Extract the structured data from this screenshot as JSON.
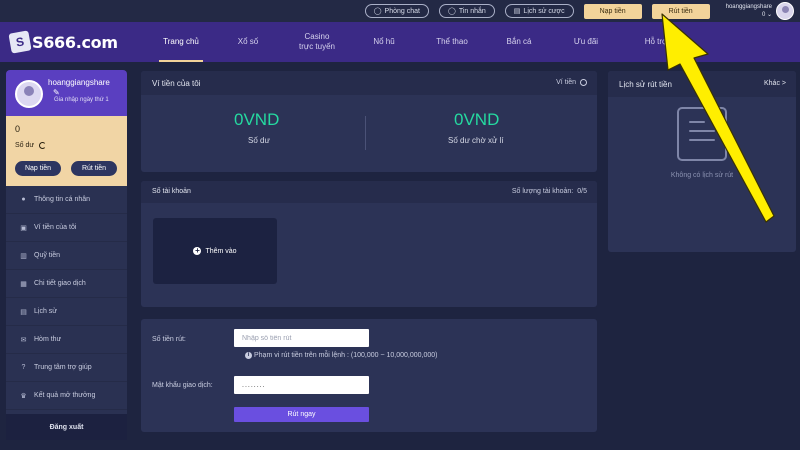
{
  "topbar": {
    "chat_label": "Phòng chat",
    "messages_label": "Tin nhắn",
    "history_label": "Lịch sử cược",
    "deposit_label": "Nạp tiền",
    "withdraw_label": "Rút tiền",
    "username": "hoanggiangshare",
    "balance": "0"
  },
  "brand": {
    "logo_text": "S666.com",
    "logo_mark": "S"
  },
  "nav": {
    "items": [
      {
        "label": "Trang chủ"
      },
      {
        "label": "Xổ số"
      },
      {
        "label": "Casino\ntrực tuyến"
      },
      {
        "label": "Nổ hũ"
      },
      {
        "label": "Thể thao"
      },
      {
        "label": "Bắn cá"
      },
      {
        "label": "Ưu đãi"
      },
      {
        "label": "Hỗ trợ"
      }
    ]
  },
  "profile": {
    "name": "hoanggiangshare",
    "subtitle": "Gia nhập ngày thứ 1",
    "balance_value": "0",
    "balance_label": "Số dư",
    "deposit_button": "Nạp tiền",
    "withdraw_button": "Rút tiền"
  },
  "sidebar": {
    "items": [
      {
        "label": "Thông tin cá nhân",
        "icon": "person-icon"
      },
      {
        "label": "Ví tiền của tôi",
        "icon": "wallet-icon"
      },
      {
        "label": "Quỹ tiền",
        "icon": "fund-icon"
      },
      {
        "label": "Chi tiết giao dịch",
        "icon": "transaction-icon"
      },
      {
        "label": "Lịch sử",
        "icon": "history-icon"
      },
      {
        "label": "Hòm thư",
        "icon": "mailbox-icon"
      },
      {
        "label": "Trung tâm trợ giúp",
        "icon": "help-icon"
      },
      {
        "label": "Kết quả mở thưởng",
        "icon": "trophy-icon"
      }
    ],
    "logout_label": "Đăng xuất"
  },
  "wallet": {
    "title": "Ví tiền của tôi",
    "header_link": "Ví tiền",
    "balance_value": "0VND",
    "balance_label": "Số dư",
    "pending_value": "0VND",
    "pending_label": "Số dư chờ xử lí"
  },
  "accounts": {
    "title": "Số tài khoản",
    "count_label": "Số lượng tài khoản:",
    "count_value": "0/5",
    "add_label": "Thêm vào"
  },
  "withdraw_form": {
    "amount_label": "Số tiền rút:",
    "amount_placeholder": "Nhập số tiền rút",
    "hint": "Phạm vi rút tiền trên mỗi lệnh : (100,000 ~ 10,000,000,000)",
    "password_label": "Mật khẩu giao dịch:",
    "password_value": "........",
    "submit_label": "Rút ngay"
  },
  "history": {
    "title": "Lịch sử rút tiền",
    "more_label": "Khác >",
    "empty_text": "Không có lịch sử rút"
  },
  "colors": {
    "accent_purple": "#3b2a86",
    "gold": "#f2d39a",
    "green_value": "#25d9a0",
    "arrow_yellow": "#ffee00"
  }
}
